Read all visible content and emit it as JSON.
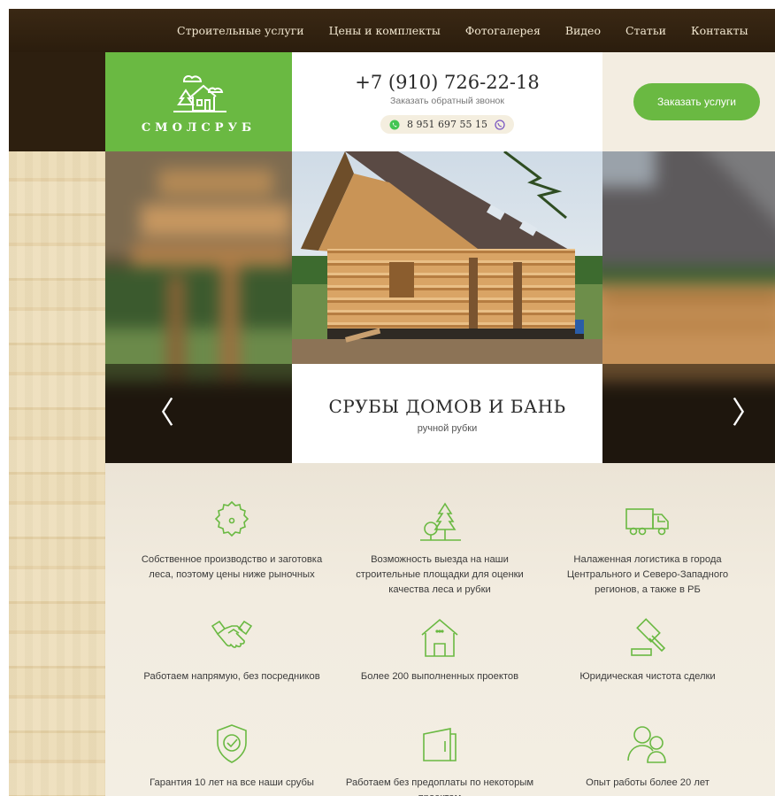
{
  "nav": {
    "items": [
      "Строительные услуги",
      "Цены и комплекты",
      "Фотогалерея",
      "Видео",
      "Статьи",
      "Контакты"
    ]
  },
  "logo": {
    "text": "СМОЛСРУБ"
  },
  "contacts": {
    "phone": "+7 (910) 726-22-18",
    "callback": "Заказать обратный звонок",
    "messenger_phone": "8 951 697 55 15"
  },
  "header": {
    "order_button": "Заказать услуги"
  },
  "slider": {
    "title": "СРУБЫ ДОМОВ И БАНЬ",
    "subtitle": "ручной рубки",
    "prev": "〈",
    "next": "〉"
  },
  "features": [
    {
      "icon": "saw-blade-icon",
      "text": "Собственное производство и заготовка леса, поэтому цены ниже рыночных"
    },
    {
      "icon": "trees-icon",
      "text": "Возможность выезда на наши строительные площадки для оценки качества леса и рубки"
    },
    {
      "icon": "truck-icon",
      "text": "Налаженная логистика в города Центрального и Северо-Западного регионов, а также в РБ"
    },
    {
      "icon": "handshake-icon",
      "text": "Работаем напрямую, без посредников"
    },
    {
      "icon": "house-icon",
      "text": "Более 200 выполненных проектов"
    },
    {
      "icon": "gavel-icon",
      "text": "Юридическая чистота сделки"
    },
    {
      "icon": "shield-icon",
      "text": "Гарантия 10 лет на все наши срубы"
    },
    {
      "icon": "wallet-icon",
      "text": "Работаем без предоплаты по некоторым проектам"
    },
    {
      "icon": "people-icon",
      "text": "Опыт работы более 20 лет"
    }
  ],
  "colors": {
    "accent": "#6ab942",
    "topbar": "#2b1d0d"
  }
}
